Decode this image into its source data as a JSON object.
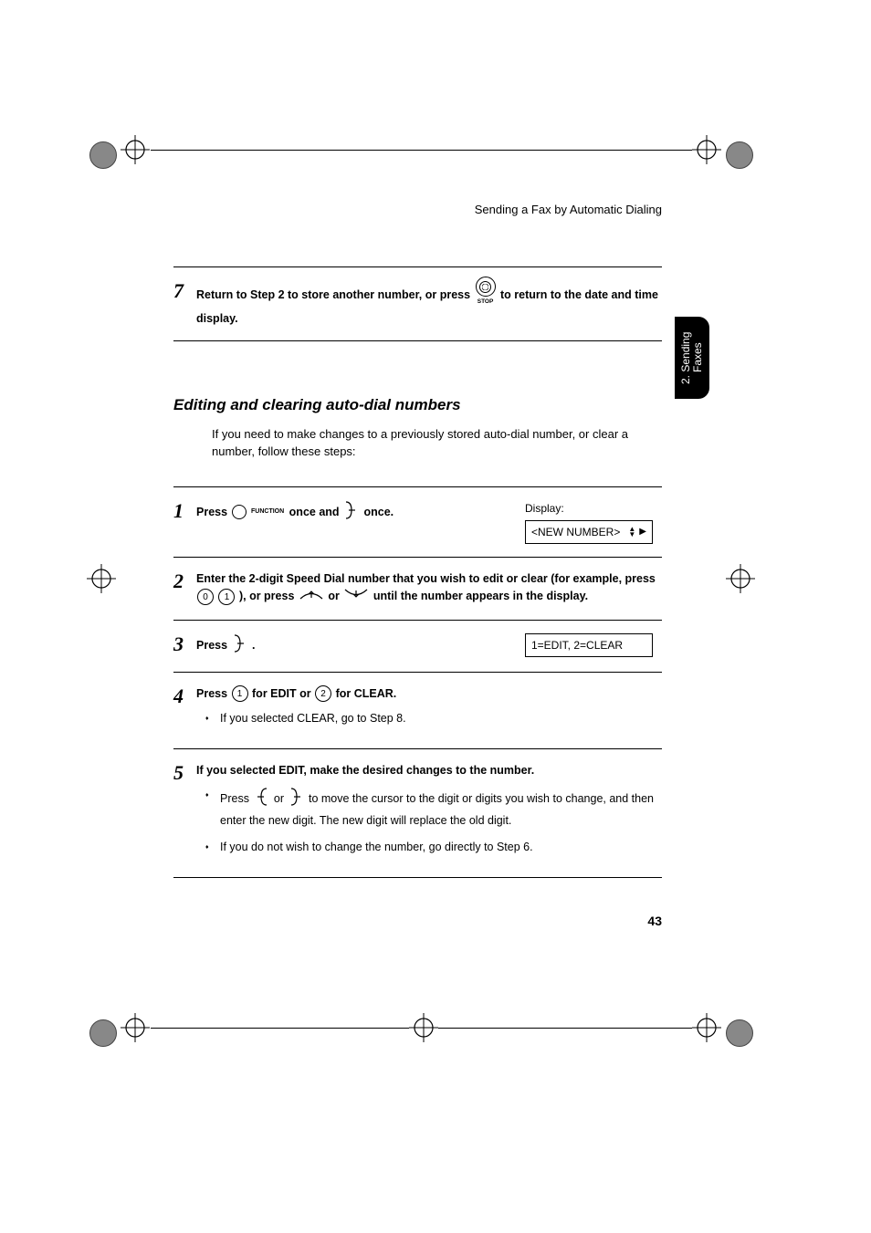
{
  "header": {
    "title": "Sending a Fax by Automatic Dialing"
  },
  "side_tab": {
    "label": "2. Sending\nFaxes"
  },
  "step7": {
    "num": "7",
    "text_a": "Return to Step 2 to store another number, or press ",
    "stop_label": "STOP",
    "text_b": " to return to the date and time display."
  },
  "section": {
    "title": "Editing and clearing auto-dial numbers",
    "intro": "If you need to make changes to a previously stored auto-dial number, or clear a number, follow these steps:"
  },
  "step1": {
    "num": "1",
    "t1": "Press ",
    "func": "FUNCTION",
    "t2": " once and ",
    "t3": " once.",
    "display_label": "Display:",
    "display_value": "<NEW NUMBER>"
  },
  "step2": {
    "num": "2",
    "t1": "Enter the 2-digit Speed Dial number that you wish to edit or clear (for example, press ",
    "d0": "0",
    "d1": "1",
    "t2": "), or press ",
    "t3": " or ",
    "t4": " until the number appears in the display."
  },
  "step3": {
    "num": "3",
    "t1": "Press ",
    "t2": ".",
    "display_value": "1=EDIT, 2=CLEAR"
  },
  "step4": {
    "num": "4",
    "t1": "Press ",
    "d1": "1",
    "t2": " for EDIT or ",
    "d2": "2",
    "t3": " for CLEAR.",
    "bullet1": "If you selected CLEAR, go to Step 8."
  },
  "step5": {
    "num": "5",
    "t1": "If you selected EDIT, make the desired changes to the number.",
    "b1a": "Press ",
    "b1b": " or ",
    "b1c": " to move the cursor to the digit or digits you wish to change, and then enter the new digit. The new digit will replace the old digit.",
    "b2": "If you do not wish to change the number, go directly to Step 6."
  },
  "page_num": "43"
}
